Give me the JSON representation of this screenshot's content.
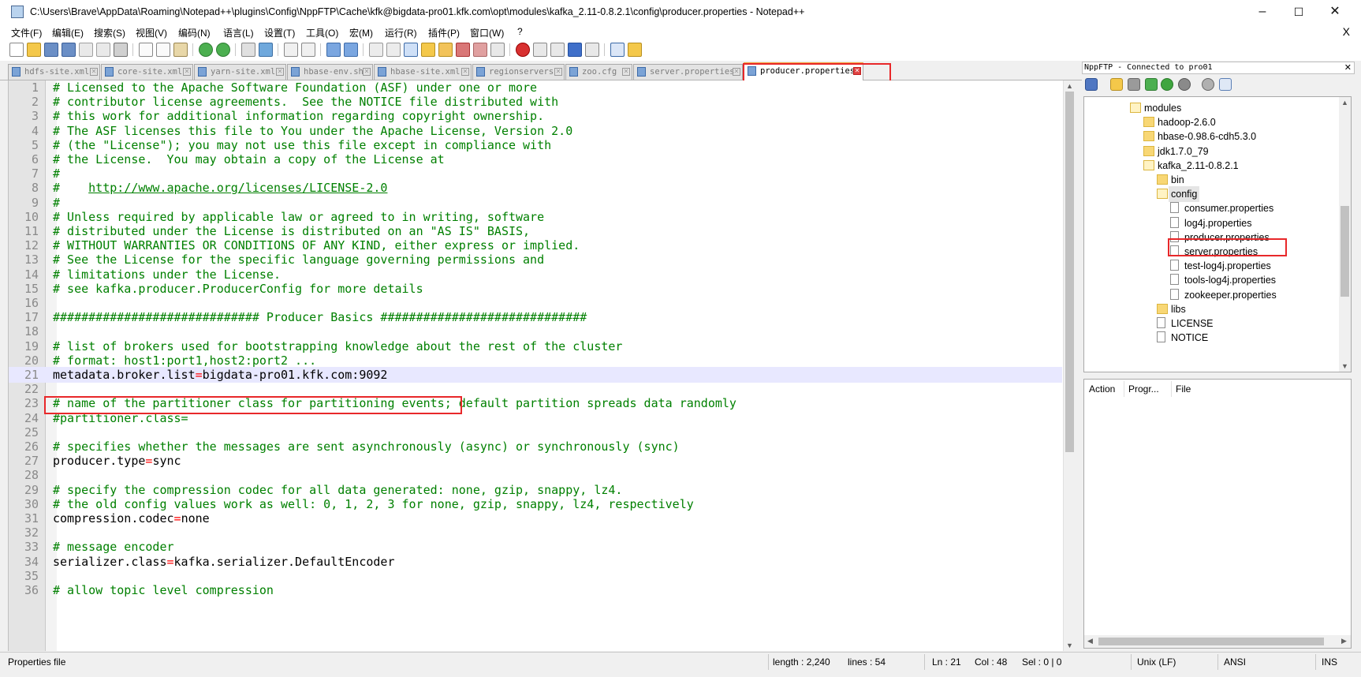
{
  "window": {
    "title": "C:\\Users\\Brave\\AppData\\Roaming\\Notepad++\\plugins\\Config\\NppFTP\\Cache\\kfk@bigdata-pro01.kfk.com\\opt\\modules\\kafka_2.11-0.8.2.1\\config\\producer.properties - Notepad++",
    "minimize": "–",
    "maximize": "☐",
    "close": "✕"
  },
  "menu": {
    "items": [
      "文件(F)",
      "编辑(E)",
      "搜索(S)",
      "视图(V)",
      "编码(N)",
      "语言(L)",
      "设置(T)",
      "工具(O)",
      "宏(M)",
      "运行(R)",
      "插件(P)",
      "窗口(W)",
      "?"
    ],
    "close": "X"
  },
  "tabs": [
    {
      "label": "hdfs-site.xml",
      "active": false
    },
    {
      "label": "core-site.xml",
      "active": false
    },
    {
      "label": "yarn-site.xml",
      "active": false
    },
    {
      "label": "hbase-env.sh",
      "active": false
    },
    {
      "label": "hbase-site.xml",
      "active": false
    },
    {
      "label": "regionservers",
      "active": false
    },
    {
      "label": "zoo.cfg",
      "active": false
    },
    {
      "label": "server.properties",
      "active": false
    },
    {
      "label": "producer.properties",
      "active": true
    }
  ],
  "editor": {
    "current_line": 21,
    "lines": [
      {
        "n": "1",
        "parts": [
          {
            "t": "# Licensed to the Apache Software Foundation (ASF) under one or more",
            "c": "comment"
          }
        ]
      },
      {
        "n": "2",
        "parts": [
          {
            "t": "# contributor license agreements.  See the NOTICE file distributed with",
            "c": "comment"
          }
        ]
      },
      {
        "n": "3",
        "parts": [
          {
            "t": "# this work for additional information regarding copyright ownership.",
            "c": "comment"
          }
        ]
      },
      {
        "n": "4",
        "parts": [
          {
            "t": "# The ASF licenses this file to You under the Apache License, Version 2.0",
            "c": "comment"
          }
        ]
      },
      {
        "n": "5",
        "parts": [
          {
            "t": "# (the \"License\"); you may not use this file except in compliance with",
            "c": "comment"
          }
        ]
      },
      {
        "n": "6",
        "parts": [
          {
            "t": "# the License.  You may obtain a copy of the License at",
            "c": "comment"
          }
        ]
      },
      {
        "n": "7",
        "parts": [
          {
            "t": "#",
            "c": "comment"
          }
        ]
      },
      {
        "n": "8",
        "parts": [
          {
            "t": "#    ",
            "c": "comment"
          },
          {
            "t": "http://www.apache.org/licenses/LICENSE-2.0",
            "c": "url"
          }
        ]
      },
      {
        "n": "9",
        "parts": [
          {
            "t": "#",
            "c": "comment"
          }
        ]
      },
      {
        "n": "10",
        "parts": [
          {
            "t": "# Unless required by applicable law or agreed to in writing, software",
            "c": "comment"
          }
        ]
      },
      {
        "n": "11",
        "parts": [
          {
            "t": "# distributed under the License is distributed on an \"AS IS\" BASIS,",
            "c": "comment"
          }
        ]
      },
      {
        "n": "12",
        "parts": [
          {
            "t": "# WITHOUT WARRANTIES OR CONDITIONS OF ANY KIND, either express or implied.",
            "c": "comment"
          }
        ]
      },
      {
        "n": "13",
        "parts": [
          {
            "t": "# See the License for the specific language governing permissions and",
            "c": "comment"
          }
        ]
      },
      {
        "n": "14",
        "parts": [
          {
            "t": "# limitations under the License.",
            "c": "comment"
          }
        ]
      },
      {
        "n": "15",
        "parts": [
          {
            "t": "# see kafka.producer.ProducerConfig for more details",
            "c": "comment"
          }
        ]
      },
      {
        "n": "16",
        "parts": []
      },
      {
        "n": "17",
        "parts": [
          {
            "t": "############################# Producer Basics #############################",
            "c": "comment"
          }
        ]
      },
      {
        "n": "18",
        "parts": []
      },
      {
        "n": "19",
        "parts": [
          {
            "t": "# list of brokers used for bootstrapping knowledge about the rest of the cluster",
            "c": "comment"
          }
        ]
      },
      {
        "n": "20",
        "parts": [
          {
            "t": "# format: host1:port1,host2:port2 ...",
            "c": "comment"
          }
        ]
      },
      {
        "n": "21",
        "parts": [
          {
            "t": "metadata.broker.list",
            "c": "key"
          },
          {
            "t": "=",
            "c": "eq"
          },
          {
            "t": "bigdata-pro01.kfk.com:9092",
            "c": "val"
          }
        ]
      },
      {
        "n": "22",
        "parts": []
      },
      {
        "n": "23",
        "parts": [
          {
            "t": "# name of the partitioner class for partitioning events; default partition spreads data randomly",
            "c": "comment"
          }
        ]
      },
      {
        "n": "24",
        "parts": [
          {
            "t": "#partitioner.class=",
            "c": "comment"
          }
        ]
      },
      {
        "n": "25",
        "parts": []
      },
      {
        "n": "26",
        "parts": [
          {
            "t": "# specifies whether the messages are sent asynchronously (async) or synchronously (sync)",
            "c": "comment"
          }
        ]
      },
      {
        "n": "27",
        "parts": [
          {
            "t": "producer.type",
            "c": "key"
          },
          {
            "t": "=",
            "c": "eq"
          },
          {
            "t": "sync",
            "c": "val"
          }
        ]
      },
      {
        "n": "28",
        "parts": []
      },
      {
        "n": "29",
        "parts": [
          {
            "t": "# specify the compression codec for all data generated: none, gzip, snappy, lz4.",
            "c": "comment"
          }
        ]
      },
      {
        "n": "30",
        "parts": [
          {
            "t": "# the old config values work as well: 0, 1, 2, 3 for none, gzip, snappy, lz4, respectively",
            "c": "comment"
          }
        ]
      },
      {
        "n": "31",
        "parts": [
          {
            "t": "compression.codec",
            "c": "key"
          },
          {
            "t": "=",
            "c": "eq"
          },
          {
            "t": "none",
            "c": "val"
          }
        ]
      },
      {
        "n": "32",
        "parts": []
      },
      {
        "n": "33",
        "parts": [
          {
            "t": "# message encoder",
            "c": "comment"
          }
        ]
      },
      {
        "n": "34",
        "parts": [
          {
            "t": "serializer.class",
            "c": "key"
          },
          {
            "t": "=",
            "c": "eq"
          },
          {
            "t": "kafka.serializer.DefaultEncoder",
            "c": "val"
          }
        ]
      },
      {
        "n": "35",
        "parts": []
      },
      {
        "n": "36",
        "parts": [
          {
            "t": "# allow topic level compression",
            "c": "comment"
          }
        ]
      }
    ]
  },
  "nppftp": {
    "title": "NppFTP - Connected to pro01",
    "close": "✕",
    "tree": [
      {
        "label": "modules",
        "type": "folder-open",
        "depth": 0
      },
      {
        "label": "hadoop-2.6.0",
        "type": "folder",
        "depth": 1
      },
      {
        "label": "hbase-0.98.6-cdh5.3.0",
        "type": "folder",
        "depth": 1
      },
      {
        "label": "jdk1.7.0_79",
        "type": "folder",
        "depth": 1
      },
      {
        "label": "kafka_2.11-0.8.2.1",
        "type": "folder-open",
        "depth": 1
      },
      {
        "label": "bin",
        "type": "folder",
        "depth": 2
      },
      {
        "label": "config",
        "type": "folder-open",
        "depth": 2,
        "selected": true
      },
      {
        "label": "consumer.properties",
        "type": "file",
        "depth": 3
      },
      {
        "label": "log4j.properties",
        "type": "file",
        "depth": 3
      },
      {
        "label": "producer.properties",
        "type": "file",
        "depth": 3,
        "highlighted": true
      },
      {
        "label": "server.properties",
        "type": "file",
        "depth": 3
      },
      {
        "label": "test-log4j.properties",
        "type": "file",
        "depth": 3
      },
      {
        "label": "tools-log4j.properties",
        "type": "file",
        "depth": 3
      },
      {
        "label": "zookeeper.properties",
        "type": "file",
        "depth": 3
      },
      {
        "label": "libs",
        "type": "folder",
        "depth": 2
      },
      {
        "label": "LICENSE",
        "type": "file",
        "depth": 2
      },
      {
        "label": "NOTICE",
        "type": "file",
        "depth": 2
      }
    ],
    "queue_columns": [
      "Action",
      "Progr...",
      "File"
    ]
  },
  "status": {
    "file_type": "Properties file",
    "length": "length : 2,240",
    "lines": "lines : 54",
    "ln": "Ln : 21",
    "col": "Col : 48",
    "sel": "Sel : 0 | 0",
    "eol": "Unix (LF)",
    "encoding": "ANSI",
    "mode": "INS"
  }
}
